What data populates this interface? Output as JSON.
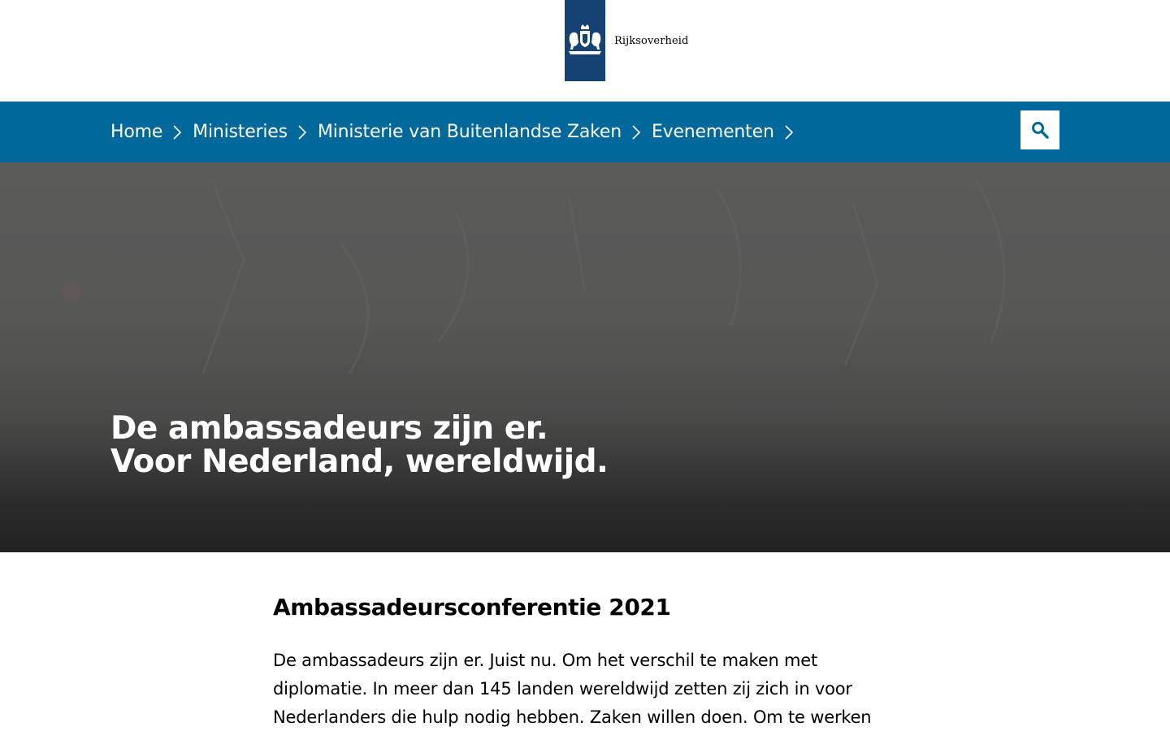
{
  "header": {
    "logo_text": "Rijksoverheid",
    "emblem_color": "#154273"
  },
  "breadcrumb": {
    "bar_color": "#01689b",
    "items": [
      {
        "label": "Home"
      },
      {
        "label": "Ministeries"
      },
      {
        "label": "Ministerie van Buitenlandse Zaken"
      },
      {
        "label": "Evenementen"
      }
    ],
    "search_icon": "search-icon"
  },
  "hero": {
    "title": "De ambassadeurs zijn er. Voor Nederland, wereldwijd."
  },
  "content": {
    "heading": "Ambassadeursconferentie 2021",
    "body": "De ambassadeurs zijn er. Juist nu. Om het verschil te maken met diplomatie. In meer dan 145 landen wereldwijd zetten zij zich in voor Nederlanders die hulp nodig hebben. Zaken willen doen. Om te werken"
  }
}
